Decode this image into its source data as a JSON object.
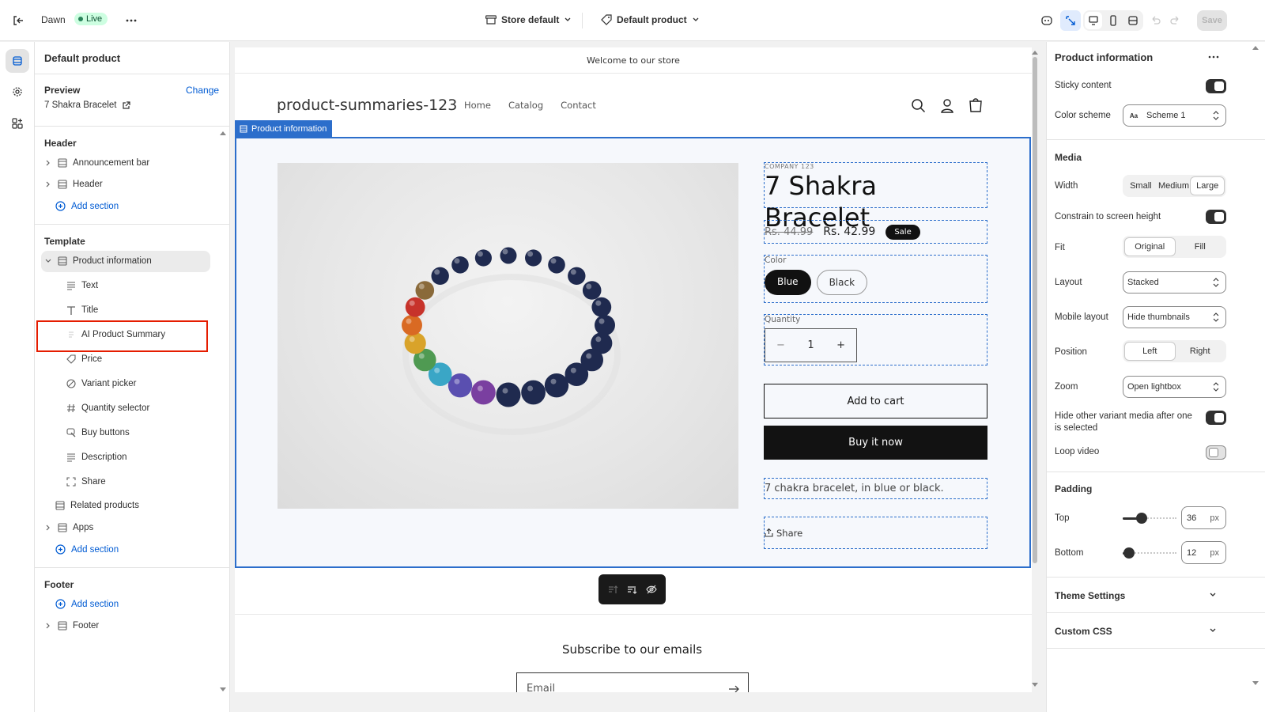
{
  "topbar": {
    "theme_name": "Dawn",
    "live_badge": "Live",
    "store_selector": "Store default",
    "template_selector": "Default product",
    "save_label": "Save"
  },
  "left_panel": {
    "title": "Default product",
    "preview_label": "Preview",
    "change_link": "Change",
    "preview_product": "7 Shakra Bracelet",
    "header_group": {
      "heading": "Header",
      "items": [
        "Announcement bar",
        "Header"
      ],
      "add_section": "Add section"
    },
    "template_group": {
      "heading": "Template",
      "section": "Product information",
      "blocks": [
        "Text",
        "Title",
        "AI Product Summary",
        "Price",
        "Variant picker",
        "Quantity selector",
        "Buy buttons",
        "Description",
        "Share"
      ],
      "related": "Related products",
      "apps": "Apps",
      "add_section": "Add section"
    },
    "footer_group": {
      "heading": "Footer",
      "add_section": "Add section",
      "footer_item": "Footer"
    }
  },
  "preview": {
    "announcement": "Welcome to our store",
    "store_title": "product-summaries-123",
    "nav": [
      "Home",
      "Catalog",
      "Contact"
    ],
    "section_tag": "Product information",
    "vendor": "COMPANY 123",
    "product_title": "7 Shakra Bracelet",
    "compare_price": "Rs. 44.99",
    "price": "Rs. 42.99",
    "sale_badge": "Sale",
    "color_label": "Color",
    "colors": [
      "Blue",
      "Black"
    ],
    "selected_color": "Blue",
    "quantity_label": "Quantity",
    "quantity_value": "1",
    "quantity_minus": "−",
    "quantity_plus": "+",
    "add_to_cart": "Add to cart",
    "buy_now": "Buy it now",
    "description": "7 chakra bracelet, in blue or black.",
    "share": "Share",
    "subscribe_heading": "Subscribe to our emails",
    "email_placeholder": "Email"
  },
  "right_panel": {
    "title": "Product information",
    "sticky_content": "Sticky content",
    "color_scheme_label": "Color scheme",
    "color_scheme_value": "Scheme 1",
    "media_heading": "Media",
    "width_label": "Width",
    "width_options": [
      "Small",
      "Medium",
      "Large"
    ],
    "width_selected": "Large",
    "constrain_label": "Constrain to screen height",
    "fit_label": "Fit",
    "fit_options": [
      "Original",
      "Fill"
    ],
    "fit_selected": "Original",
    "layout_label": "Layout",
    "layout_value": "Stacked",
    "mobile_layout_label": "Mobile layout",
    "mobile_layout_value": "Hide thumbnails",
    "position_label": "Position",
    "position_options": [
      "Left",
      "Right"
    ],
    "position_selected": "Left",
    "zoom_label": "Zoom",
    "zoom_value": "Open lightbox",
    "hide_variant_label": "Hide other variant media after one is selected",
    "loop_video_label": "Loop video",
    "padding_heading": "Padding",
    "top_label": "Top",
    "top_value": "36",
    "bottom_label": "Bottom",
    "bottom_value": "12",
    "unit": "px",
    "theme_settings": "Theme Settings",
    "custom_css": "Custom CSS",
    "toggles": {
      "sticky": true,
      "constrain": true,
      "hide_variant": true,
      "loop_video": false
    },
    "padding_fraction": {
      "top": 0.36,
      "bottom": 0.12
    }
  },
  "colors": {
    "accent": "#005bd3",
    "selection": "#2c6ecb",
    "highlight_box": "#e51c00"
  }
}
